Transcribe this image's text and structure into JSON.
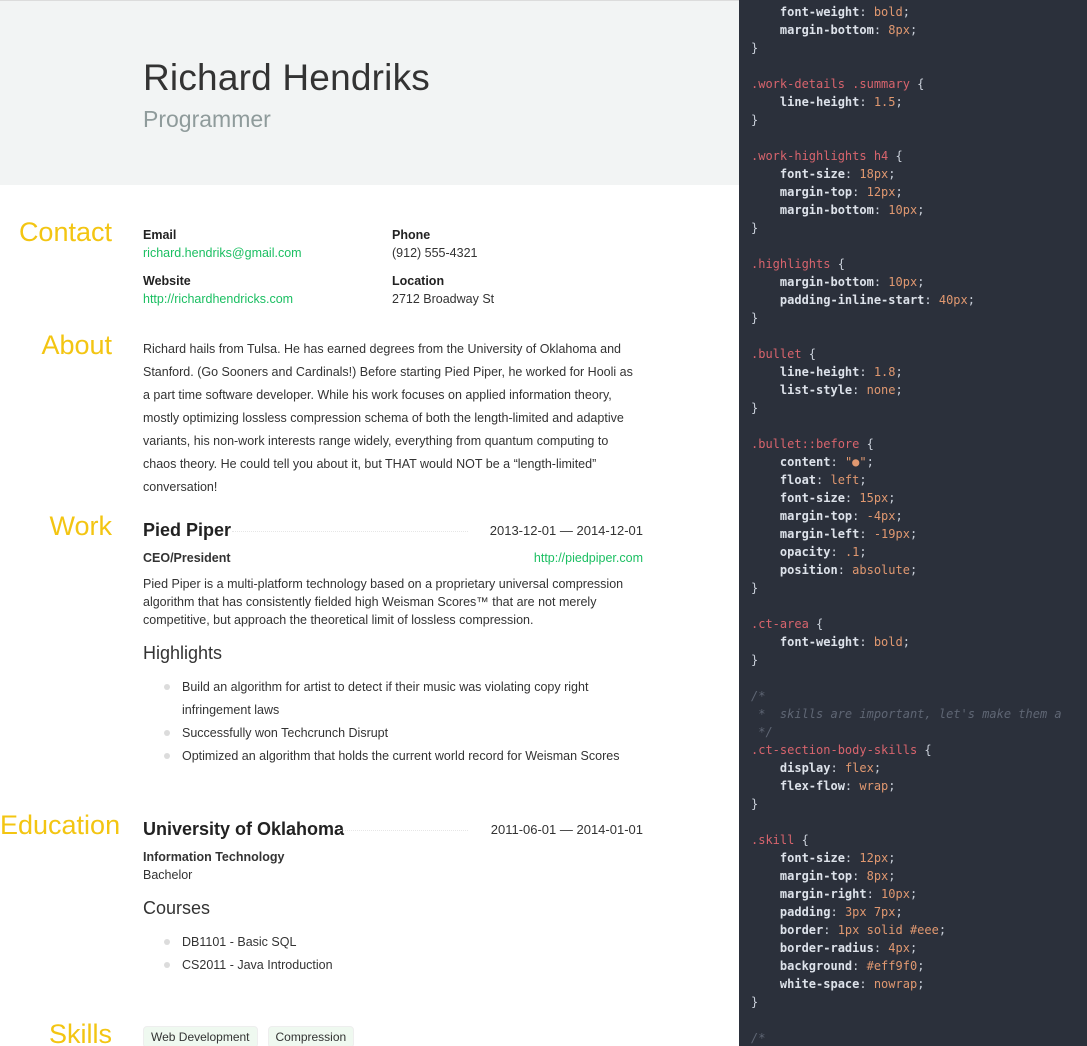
{
  "basics": {
    "name": "Richard Hendriks",
    "label": "Programmer",
    "email_label": "Email",
    "email": "richard.hendriks@gmail.com",
    "phone_label": "Phone",
    "phone": "(912) 555-4321",
    "website_label": "Website",
    "website": "http://richardhendricks.com",
    "location_label": "Location",
    "location": "2712 Broadway St"
  },
  "sections": {
    "contact": "Contact",
    "about": "About",
    "work": "Work",
    "education": "Education",
    "skills": "Skills"
  },
  "about": "Richard hails from Tulsa. He has earned degrees from the University of Oklahoma and Stanford. (Go Sooners and Cardinals!) Before starting Pied Piper, he worked for Hooli as a part time software developer. While his work focuses on applied information theory, mostly optimizing lossless compression schema of both the length-limited and adaptive variants, his non-work interests range widely, everything from quantum computing to chaos theory. He could tell you about it, but THAT would NOT be a “length-limited” conversation!",
  "work": {
    "company": "Pied Piper",
    "dates": "2013-12-01 — 2014-12-01",
    "position": "CEO/President",
    "url": "http://piedpiper.com",
    "summary": "Pied Piper is a multi-platform technology based on a proprietary universal compression algorithm that has consistently fielded high Weisman Scores™ that are not merely competitive, but approach the theoretical limit of lossless compression.",
    "highlights_title": "Highlights",
    "highlights": [
      "Build an algorithm for artist to detect if their music was violating copy right infringement laws",
      "Successfully won Techcrunch Disrupt",
      "Optimized an algorithm that holds the current world record for Weisman Scores"
    ]
  },
  "education": {
    "institution": "University of Oklahoma",
    "dates": "2011-06-01 — 2014-01-01",
    "area": "Information Technology",
    "study_type": "Bachelor",
    "courses_title": "Courses",
    "courses": [
      "DB1101 - Basic SQL",
      "CS2011 - Java Introduction"
    ]
  },
  "skills": [
    "Web Development",
    "Compression"
  ],
  "editor": {
    "lines": [
      [
        [
          "p",
          "    font-weight"
        ],
        [
          "u",
          ": "
        ],
        [
          "v",
          "bold"
        ],
        [
          "u",
          ";"
        ]
      ],
      [
        [
          "p",
          "    margin-bottom"
        ],
        [
          "u",
          ": "
        ],
        [
          "v",
          "8px"
        ],
        [
          "u",
          ";"
        ]
      ],
      [
        [
          "u",
          "}"
        ]
      ],
      [],
      [
        [
          "s",
          ".work-details .summary"
        ],
        [
          "u",
          " {"
        ]
      ],
      [
        [
          "p",
          "    line-height"
        ],
        [
          "u",
          ": "
        ],
        [
          "v",
          "1.5"
        ],
        [
          "u",
          ";"
        ]
      ],
      [
        [
          "u",
          "}"
        ]
      ],
      [],
      [
        [
          "s",
          ".work-highlights h4"
        ],
        [
          "u",
          " {"
        ]
      ],
      [
        [
          "p",
          "    font-size"
        ],
        [
          "u",
          ": "
        ],
        [
          "v",
          "18px"
        ],
        [
          "u",
          ";"
        ]
      ],
      [
        [
          "p",
          "    margin-top"
        ],
        [
          "u",
          ": "
        ],
        [
          "v",
          "12px"
        ],
        [
          "u",
          ";"
        ]
      ],
      [
        [
          "p",
          "    margin-bottom"
        ],
        [
          "u",
          ": "
        ],
        [
          "v",
          "10px"
        ],
        [
          "u",
          ";"
        ]
      ],
      [
        [
          "u",
          "}"
        ]
      ],
      [],
      [
        [
          "s",
          ".highlights"
        ],
        [
          "u",
          " {"
        ]
      ],
      [
        [
          "p",
          "    margin-bottom"
        ],
        [
          "u",
          ": "
        ],
        [
          "v",
          "10px"
        ],
        [
          "u",
          ";"
        ]
      ],
      [
        [
          "p",
          "    padding-inline-start"
        ],
        [
          "u",
          ": "
        ],
        [
          "v",
          "40px"
        ],
        [
          "u",
          ";"
        ]
      ],
      [
        [
          "u",
          "}"
        ]
      ],
      [],
      [
        [
          "s",
          ".bullet"
        ],
        [
          "u",
          " {"
        ]
      ],
      [
        [
          "p",
          "    line-height"
        ],
        [
          "u",
          ": "
        ],
        [
          "v",
          "1.8"
        ],
        [
          "u",
          ";"
        ]
      ],
      [
        [
          "p",
          "    list-style"
        ],
        [
          "u",
          ": "
        ],
        [
          "v",
          "none"
        ],
        [
          "u",
          ";"
        ]
      ],
      [
        [
          "u",
          "}"
        ]
      ],
      [],
      [
        [
          "s",
          ".bullet::before"
        ],
        [
          "u",
          " {"
        ]
      ],
      [
        [
          "p",
          "    content"
        ],
        [
          "u",
          ": "
        ],
        [
          "v",
          "\"●\""
        ],
        [
          "u",
          ";"
        ]
      ],
      [
        [
          "p",
          "    float"
        ],
        [
          "u",
          ": "
        ],
        [
          "v",
          "left"
        ],
        [
          "u",
          ";"
        ]
      ],
      [
        [
          "p",
          "    font-size"
        ],
        [
          "u",
          ": "
        ],
        [
          "v",
          "15px"
        ],
        [
          "u",
          ";"
        ]
      ],
      [
        [
          "p",
          "    margin-top"
        ],
        [
          "u",
          ": "
        ],
        [
          "v",
          "-4px"
        ],
        [
          "u",
          ";"
        ]
      ],
      [
        [
          "p",
          "    margin-left"
        ],
        [
          "u",
          ": "
        ],
        [
          "v",
          "-19px"
        ],
        [
          "u",
          ";"
        ]
      ],
      [
        [
          "p",
          "    opacity"
        ],
        [
          "u",
          ": "
        ],
        [
          "v",
          ".1"
        ],
        [
          "u",
          ";"
        ]
      ],
      [
        [
          "p",
          "    position"
        ],
        [
          "u",
          ": "
        ],
        [
          "v",
          "absolute"
        ],
        [
          "u",
          ";"
        ]
      ],
      [
        [
          "u",
          "}"
        ]
      ],
      [],
      [
        [
          "s",
          ".ct-area"
        ],
        [
          "u",
          " {"
        ]
      ],
      [
        [
          "p",
          "    font-weight"
        ],
        [
          "u",
          ": "
        ],
        [
          "v",
          "bold"
        ],
        [
          "u",
          ";"
        ]
      ],
      [
        [
          "u",
          "}"
        ]
      ],
      [],
      [
        [
          "c",
          "/*"
        ]
      ],
      [
        [
          "c",
          " *  skills are important, let's make them a"
        ]
      ],
      [
        [
          "c",
          " */"
        ]
      ],
      [
        [
          "s",
          ".ct-section-body-skills"
        ],
        [
          "u",
          " {"
        ]
      ],
      [
        [
          "p",
          "    display"
        ],
        [
          "u",
          ": "
        ],
        [
          "v",
          "flex"
        ],
        [
          "u",
          ";"
        ]
      ],
      [
        [
          "p",
          "    flex-flow"
        ],
        [
          "u",
          ": "
        ],
        [
          "v",
          "wrap"
        ],
        [
          "u",
          ";"
        ]
      ],
      [
        [
          "u",
          "}"
        ]
      ],
      [],
      [
        [
          "s",
          ".skill"
        ],
        [
          "u",
          " {"
        ]
      ],
      [
        [
          "p",
          "    font-size"
        ],
        [
          "u",
          ": "
        ],
        [
          "v",
          "12px"
        ],
        [
          "u",
          ";"
        ]
      ],
      [
        [
          "p",
          "    margin-top"
        ],
        [
          "u",
          ": "
        ],
        [
          "v",
          "8px"
        ],
        [
          "u",
          ";"
        ]
      ],
      [
        [
          "p",
          "    margin-right"
        ],
        [
          "u",
          ": "
        ],
        [
          "v",
          "10px"
        ],
        [
          "u",
          ";"
        ]
      ],
      [
        [
          "p",
          "    padding"
        ],
        [
          "u",
          ": "
        ],
        [
          "v",
          "3px 7px"
        ],
        [
          "u",
          ";"
        ]
      ],
      [
        [
          "p",
          "    border"
        ],
        [
          "u",
          ": "
        ],
        [
          "v",
          "1px solid #eee"
        ],
        [
          "u",
          ";"
        ]
      ],
      [
        [
          "p",
          "    border-radius"
        ],
        [
          "u",
          ": "
        ],
        [
          "v",
          "4px"
        ],
        [
          "u",
          ";"
        ]
      ],
      [
        [
          "p",
          "    background"
        ],
        [
          "u",
          ": "
        ],
        [
          "v",
          "#eff9f0"
        ],
        [
          "u",
          ";"
        ]
      ],
      [
        [
          "p",
          "    white-space"
        ],
        [
          "u",
          ": "
        ],
        [
          "v",
          "nowrap"
        ],
        [
          "u",
          ";"
        ]
      ],
      [
        [
          "u",
          "}"
        ]
      ],
      [],
      [
        [
          "c",
          "/*"
        ]
      ]
    ]
  },
  "colors": {
    "accent": "#f3c512",
    "link": "#1bbf62",
    "header_bg": "#f2f4f4",
    "editor_bg": "#2b303b",
    "code_selector": "#d8646d",
    "code_value": "#e09870"
  }
}
